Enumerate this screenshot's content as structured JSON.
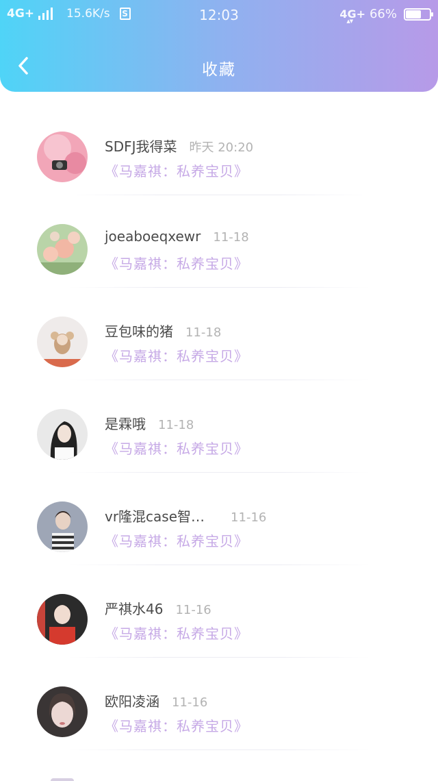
{
  "status_bar": {
    "network_left": "4G+",
    "speed": "15.6K/s",
    "s_badge": "S",
    "time": "12:03",
    "network_right": "4G+",
    "battery_percent": "66%",
    "battery_level": 0.66
  },
  "header": {
    "title": "收藏",
    "back_icon": "chevron-left-icon",
    "gradient": [
      "#4fd4f7",
      "#8eb2f0",
      "#b79ae8"
    ]
  },
  "items": [
    {
      "name": "SDFJ我得菜",
      "time": "昨天 20:20",
      "title": "《马嘉祺：私养宝贝》"
    },
    {
      "name": "joeaboeqxewr",
      "time": "11-18",
      "title": "《马嘉祺：私养宝贝》"
    },
    {
      "name": "豆包味的猪",
      "time": "11-18",
      "title": "《马嘉祺：私养宝贝》"
    },
    {
      "name": "是霖哦",
      "time": "11-18",
      "title": "《马嘉祺：私养宝贝》"
    },
    {
      "name": "vr隆混case智…",
      "time": "11-16",
      "title": "《马嘉祺：私养宝贝》"
    },
    {
      "name": "严祺水46",
      "time": "11-16",
      "title": "《马嘉祺：私养宝贝》"
    },
    {
      "name": "欧阳凌涵",
      "time": "11-16",
      "title": "《马嘉祺：私养宝贝》"
    }
  ],
  "colors": {
    "name_text": "#4a4a4a",
    "time_text": "#b3b3b3",
    "fav_title_text": "#c6a9e6"
  }
}
